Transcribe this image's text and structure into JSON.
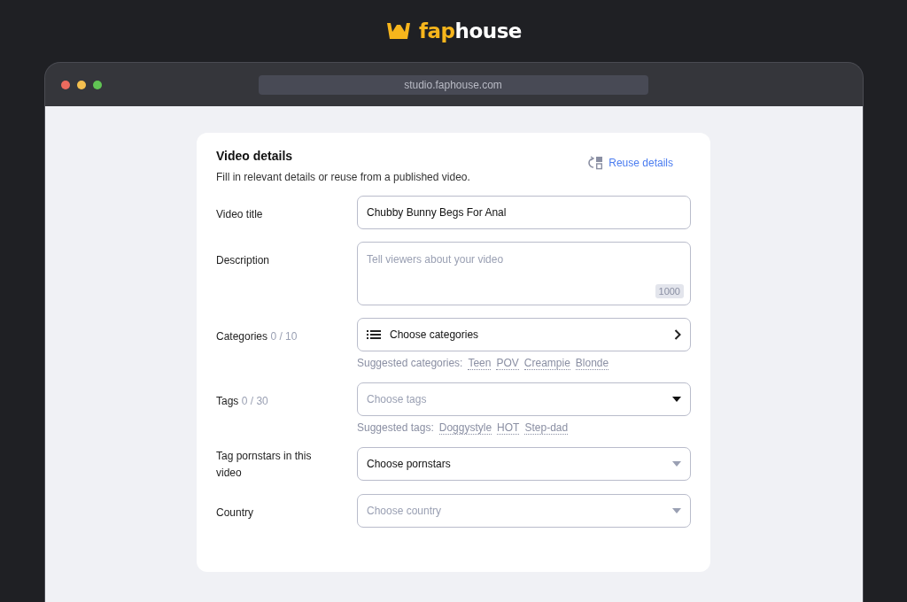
{
  "logo": {
    "accent": "fap",
    "rest": "house"
  },
  "browser": {
    "address": "studio.faphouse.com"
  },
  "card": {
    "title": "Video details",
    "subtitle": "Fill in relevant details or reuse from a published video.",
    "action": "Reuse details"
  },
  "fields": [
    {
      "kind": "text",
      "label": "Video title",
      "value": "Chubby Bunny Begs For Anal"
    },
    {
      "kind": "textarea",
      "label": "Description",
      "placeholder": "Tell viewers about your video",
      "counter": "1000"
    },
    {
      "kind": "picker",
      "label": "Categories",
      "count": "0 / 10",
      "value": "Choose categories",
      "suggest_label": "Suggested categories:",
      "suggestions": [
        "Teen",
        "POV",
        "Creampie",
        "Blonde"
      ]
    },
    {
      "kind": "multiselect",
      "label": "Tags",
      "count": "0 / 30",
      "placeholder": "Choose tags",
      "suggest_label": "Suggested tags:",
      "suggestions": [
        "Doggystyle",
        "HOT",
        "Step-dad"
      ]
    },
    {
      "kind": "select",
      "label": "Tag pornstars in this video",
      "value": "Choose pornstars"
    },
    {
      "kind": "select",
      "label": "Country",
      "placeholder": "Choose country"
    }
  ]
}
